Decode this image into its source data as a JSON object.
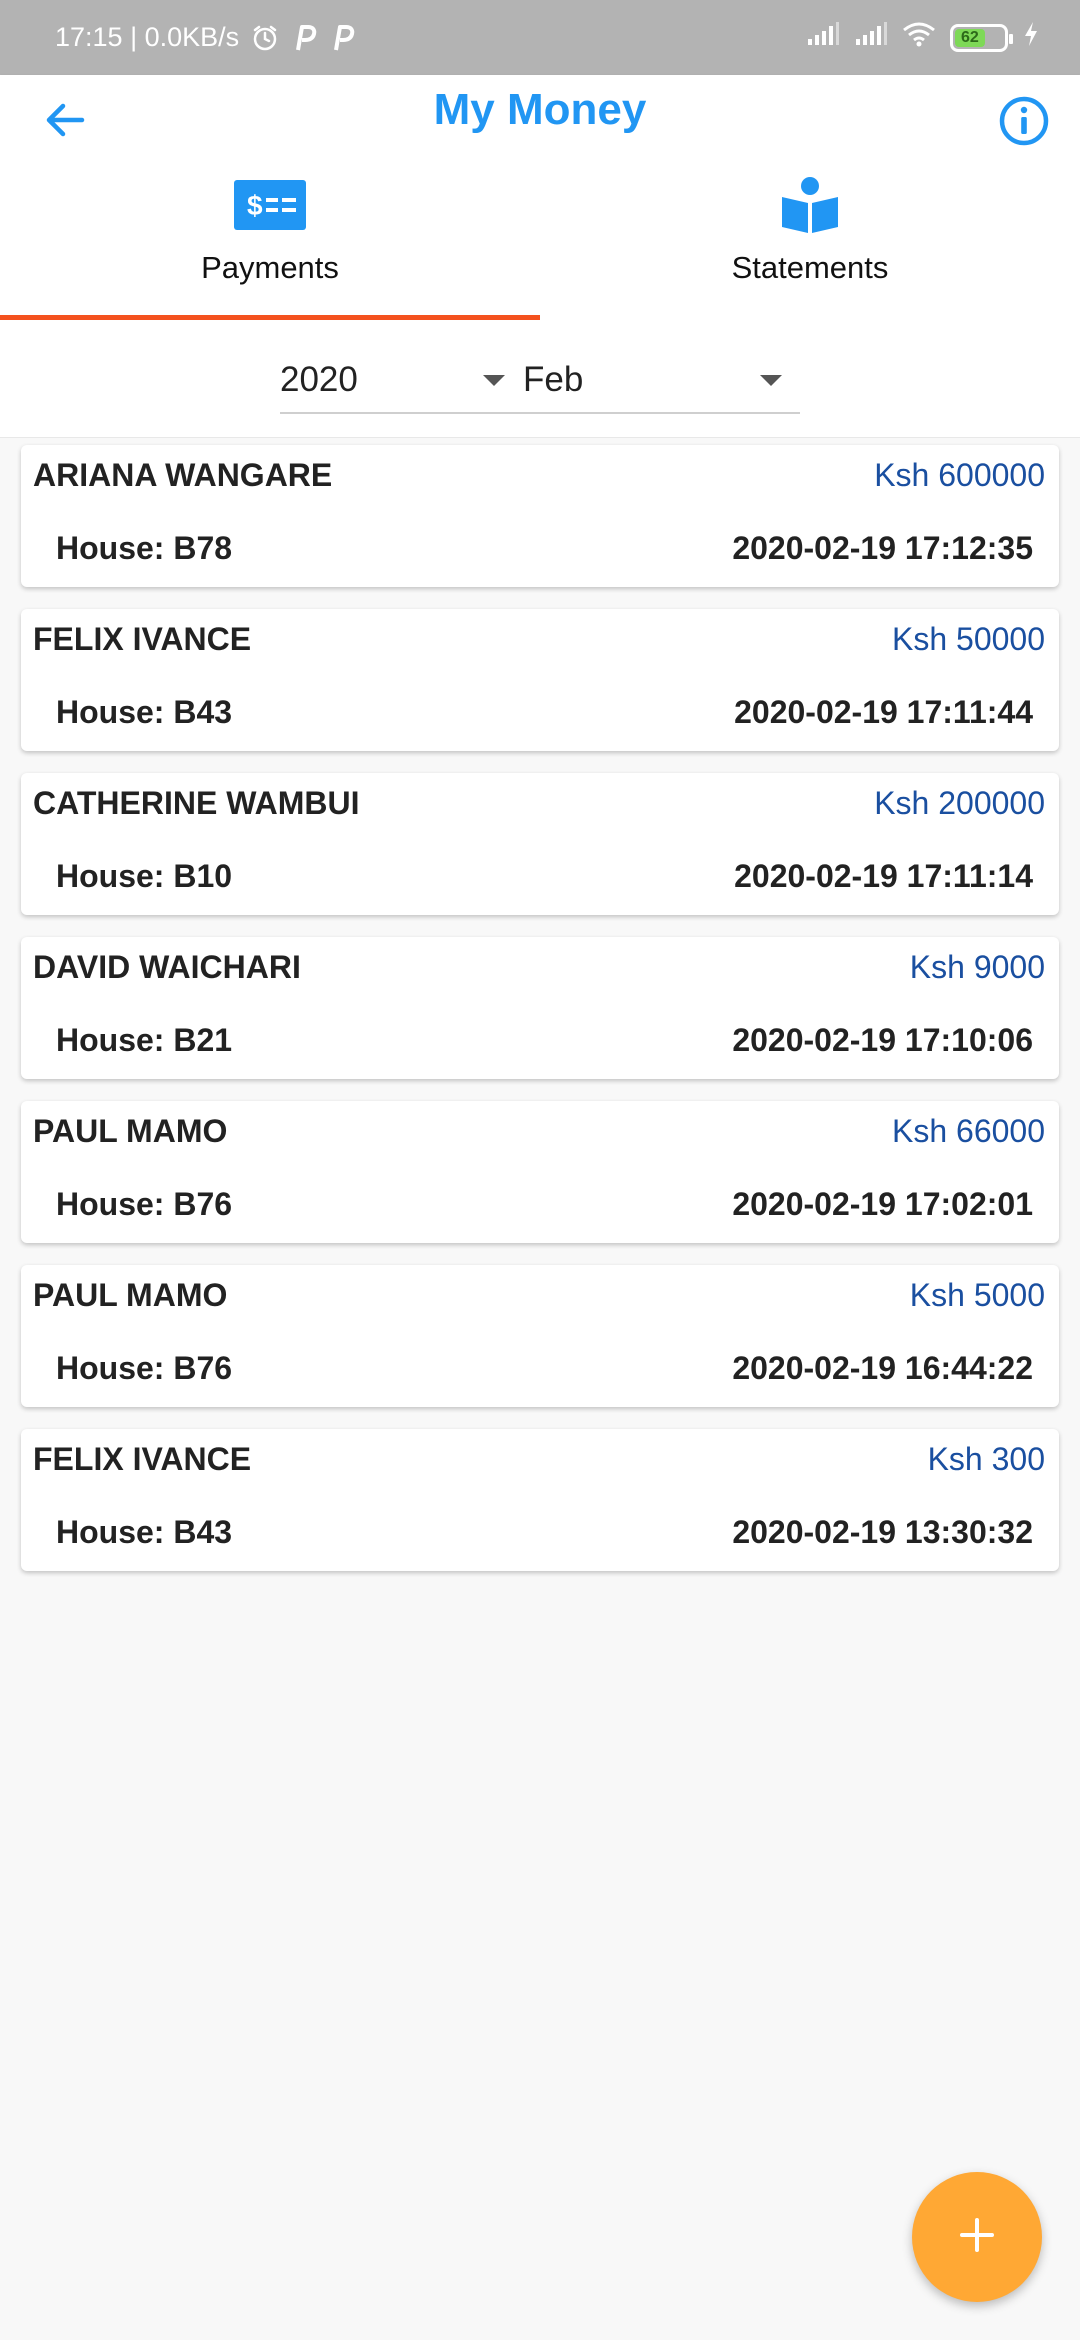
{
  "status_bar": {
    "time_speed": "17:15 | 0.0KB/s",
    "battery_level": "62",
    "icons": [
      "alarm-icon",
      "p-icon",
      "p-icon",
      "signal-icon",
      "signal-icon",
      "wifi-icon",
      "battery-icon",
      "charging-icon"
    ]
  },
  "app_bar": {
    "title": "My Money",
    "back_icon": "arrow-left-icon",
    "info_icon": "info-icon"
  },
  "tabs": [
    {
      "label": "Payments",
      "icon": "payment-card-icon",
      "selected": true
    },
    {
      "label": "Statements",
      "icon": "reading-book-icon",
      "selected": false
    }
  ],
  "filters": {
    "year": "2020",
    "month": "Feb"
  },
  "payments": [
    {
      "name": "ARIANA WANGARE",
      "amount": "Ksh 600000",
      "house": "House: B78",
      "date": "2020-02-19 17:12:35"
    },
    {
      "name": "FELIX IVANCE",
      "amount": "Ksh 50000",
      "house": "House: B43",
      "date": "2020-02-19 17:11:44"
    },
    {
      "name": "CATHERINE WAMBUI",
      "amount": "Ksh 200000",
      "house": "House: B10",
      "date": "2020-02-19 17:11:14"
    },
    {
      "name": "DAVID WAICHARI",
      "amount": "Ksh 9000",
      "house": "House: B21",
      "date": "2020-02-19 17:10:06"
    },
    {
      "name": "PAUL MAMO",
      "amount": "Ksh 66000",
      "house": "House: B76",
      "date": "2020-02-19 17:02:01"
    },
    {
      "name": "PAUL MAMO",
      "amount": "Ksh 5000",
      "house": "House: B76",
      "date": "2020-02-19 16:44:22"
    },
    {
      "name": "FELIX IVANCE",
      "amount": "Ksh 300",
      "house": "House: B43",
      "date": "2020-02-19 13:30:32"
    }
  ],
  "fab": {
    "icon": "plus-icon"
  },
  "colors": {
    "accent": "#2196f3",
    "tab_indicator": "#f4511e",
    "amount": "#1a4fa0",
    "fab": "#ffa834",
    "status_bar": "#b3b3b3"
  }
}
